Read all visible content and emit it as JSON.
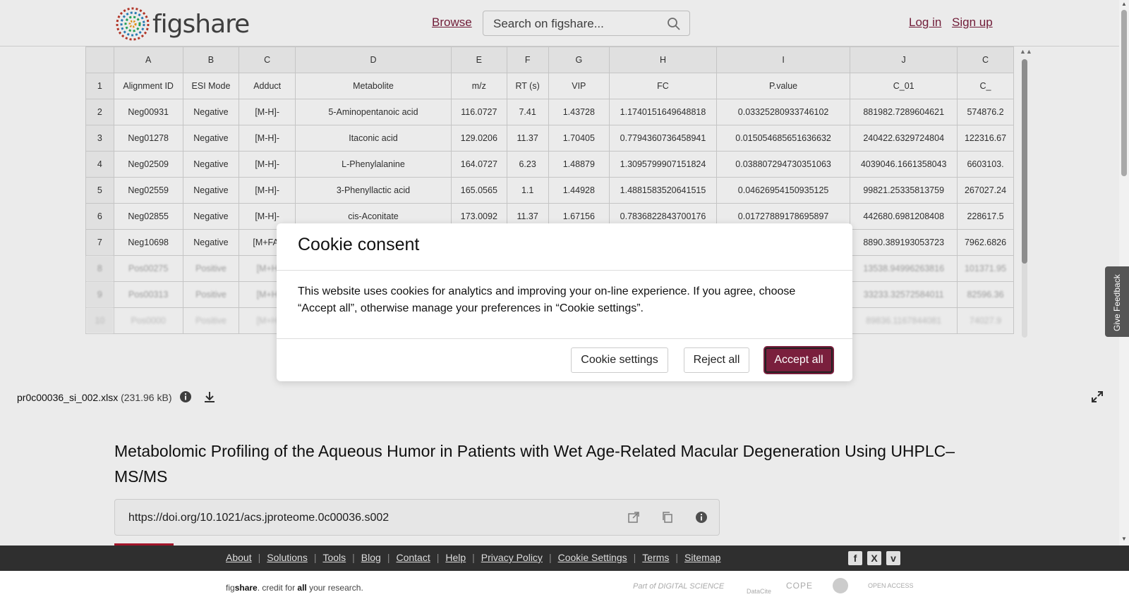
{
  "header": {
    "logo_text": "figshare",
    "browse": "Browse",
    "search_placeholder": "Search on figshare...",
    "login": "Log in",
    "signup": "Sign up"
  },
  "sheet": {
    "columns": [
      "A",
      "B",
      "C",
      "D",
      "E",
      "F",
      "G",
      "H",
      "I",
      "J",
      "C"
    ],
    "rows": [
      [
        "1",
        "Alignment ID",
        "ESI Mode",
        "Adduct",
        "Metabolite",
        "m/z",
        "RT (s)",
        "VIP",
        "FC",
        "P.value",
        "C_01",
        "C_"
      ],
      [
        "2",
        "Neg00931",
        "Negative",
        "[M-H]-",
        "5-Aminopentanoic acid",
        "116.0727",
        "7.41",
        "1.43728",
        "1.1740151649648818",
        "0.03325280933746102",
        "881982.7289604621",
        "574876.2"
      ],
      [
        "3",
        "Neg01278",
        "Negative",
        "[M-H]-",
        "Itaconic acid",
        "129.0206",
        "11.37",
        "1.70405",
        "0.7794360736458941",
        "0.015054685651636632",
        "240422.6329724804",
        "122316.67"
      ],
      [
        "4",
        "Neg02509",
        "Negative",
        "[M-H]-",
        "L-Phenylalanine",
        "164.0727",
        "6.23",
        "1.48879",
        "1.3095799907151824",
        "0.038807294730351063",
        "4039046.1661358043",
        "6603103."
      ],
      [
        "5",
        "Neg02559",
        "Negative",
        "[M-H]-",
        "3-Phenyllactic acid",
        "165.0565",
        "1.1",
        "1.44928",
        "1.4881583520641515",
        "0.04626954150935125",
        "99821.25335813759",
        "267027.24"
      ],
      [
        "6",
        "Neg02855",
        "Negative",
        "[M-H]-",
        "cis-Aconitate",
        "173.0092",
        "11.37",
        "1.67156",
        "0.7836822843700176",
        "0.01727889178695897",
        "442680.6981208408",
        "228617.5"
      ],
      [
        "7",
        "Neg10698",
        "Negative",
        "[M+FA-",
        "",
        "",
        "",
        "",
        "",
        "",
        "8890.389193053723",
        "7962.6826"
      ],
      [
        "8",
        "Pos00275",
        "Positive",
        "[M+H",
        "",
        "",
        "",
        "",
        "",
        "",
        "13538.94996263816",
        "101371.95"
      ],
      [
        "9",
        "Pos00313",
        "Positive",
        "[M+H",
        "",
        "",
        "",
        "",
        "",
        "",
        "33233.32572584011",
        "82596.36"
      ],
      [
        "10",
        "Pos0000",
        "Positive",
        "[M+H",
        "",
        "",
        "",
        "",
        "",
        "",
        "89836.1167844081",
        "74027.9"
      ]
    ]
  },
  "file": {
    "name": "pr0c00036_si_002.xlsx",
    "size": "(231.96 kB)"
  },
  "article": {
    "title": "Metabolomic Profiling of the Aqueous Humor in Patients with Wet Age-Related Macular Degeneration Using UHPLC–MS/MS",
    "doi": "https://doi.org/10.1021/acs.jproteome.0c00036.s002"
  },
  "feedback": "Give Feedback",
  "cookie": {
    "title": "Cookie consent",
    "body": "This website uses cookies for analytics and improving your on-line experience. If you agree, choose “Accept all”, otherwise manage your preferences in “Cookie settings”.",
    "settings": "Cookie settings",
    "reject": "Reject all",
    "accept": "Accept all"
  },
  "footer": {
    "links": [
      "About",
      "Solutions",
      "Tools",
      "Blog",
      "Contact",
      "Help",
      "Privacy Policy",
      "Cookie Settings",
      "Terms",
      "Sitemap"
    ],
    "tagline_pre": "fig",
    "tagline_bold": "share",
    "tagline_mid": ". credit for ",
    "tagline_all": "all",
    "tagline_end": " your research.",
    "partner_ds": "Part of DIGITAL SCIENCE",
    "partner_dc": "DataCite",
    "partner_cope": "COPE",
    "partner_oa": "OPEN ACCESS"
  },
  "colors": {
    "brand": "#7a1f3d",
    "footer_bg": "#2f2f2f"
  }
}
